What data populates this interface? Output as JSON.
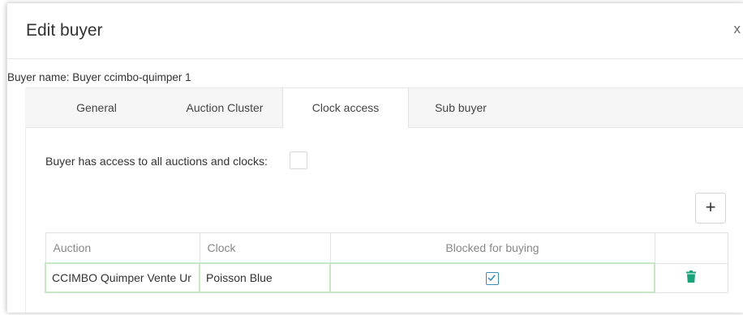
{
  "dialog": {
    "title": "Edit buyer",
    "close_glyph": "x"
  },
  "buyer": {
    "name_label": "Buyer name: Buyer ccimbo-quimper 1"
  },
  "tabs": [
    {
      "label": "General",
      "active": false
    },
    {
      "label": "Auction Cluster",
      "active": false
    },
    {
      "label": "Clock access",
      "active": true
    },
    {
      "label": "Sub buyer",
      "active": false
    }
  ],
  "access": {
    "label": "Buyer has access to all auctions and clocks:",
    "checked": false
  },
  "add_button": {
    "label": "+"
  },
  "table": {
    "columns": [
      "Auction",
      "Clock",
      "Blocked for buying",
      ""
    ],
    "rows": [
      {
        "auction": "CCIMBO Quimper Vente Ur",
        "clock": "Poisson Blue",
        "blocked": true
      }
    ]
  },
  "colors": {
    "accent": "#3c8dbc",
    "trash": "#1aa37a",
    "row_highlight": "#c6e8c6"
  },
  "icons": [
    "close-icon",
    "plus-icon",
    "checkbox-checked-icon",
    "trash-icon"
  ]
}
